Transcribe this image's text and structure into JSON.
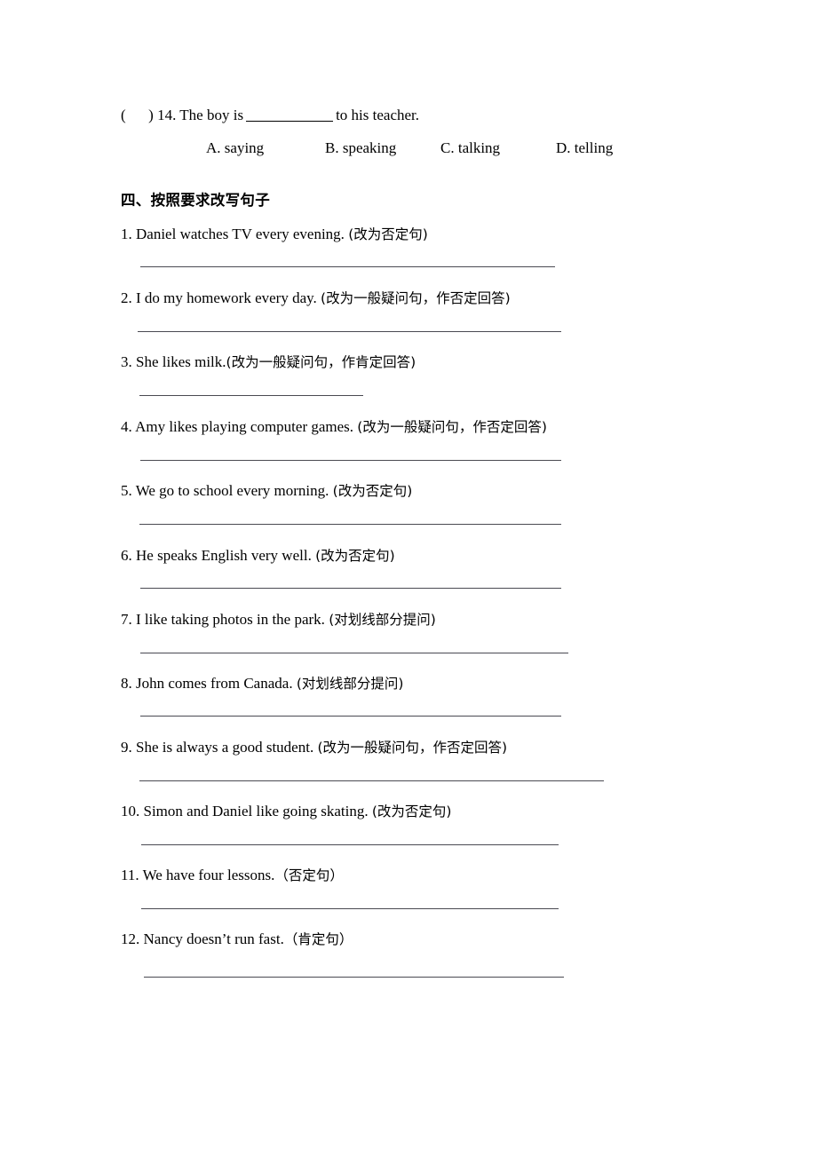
{
  "document": {
    "multiple_choice": {
      "bracket_open": "(",
      "bracket_close": ")",
      "number": "14.",
      "stem_before_blank": "The boy is",
      "stem_after_blank": "to his teacher.",
      "options": [
        {
          "key": "A.",
          "text": "saying"
        },
        {
          "key": "B.",
          "text": "speaking"
        },
        {
          "key": "C.",
          "text": "talking"
        },
        {
          "key": "D.",
          "text": "telling"
        }
      ],
      "full_line": "(      ) 14. The boy is __________ to his teacher."
    },
    "section": {
      "heading": "四、按照要求改写句子"
    },
    "items": [
      {
        "number": "1.",
        "sentence": "Daniel watches TV every evening.",
        "instruction": "(改为否定句)"
      },
      {
        "number": "2.",
        "sentence": "I do my homework every day.",
        "instruction": "(改为一般疑问句，作否定回答)"
      },
      {
        "number": "3.",
        "sentence": "She likes milk.",
        "instruction": "(改为一般疑问句，作肯定回答)"
      },
      {
        "number": "4.",
        "sentence": "Amy likes playing computer games.",
        "instruction": "(改为一般疑问句，作否定回答)"
      },
      {
        "number": "5.",
        "sentence": "We go to school every morning.",
        "instruction": "(改为否定句)"
      },
      {
        "number": "6.",
        "sentence": "He speaks English very well.",
        "instruction": "(改为否定句)"
      },
      {
        "number": "7.",
        "sentence": "I like taking photos in the park.",
        "instruction": "(对划线部分提问)"
      },
      {
        "number": "8.",
        "sentence": "John comes from Canada.",
        "instruction": "(对划线部分提问)"
      },
      {
        "number": "9.",
        "sentence": "She is always a good student.",
        "instruction": "(改为一般疑问句，作否定回答)"
      },
      {
        "number": "10.",
        "sentence": "Simon and Daniel like going skating.",
        "instruction": "(改为否定句)"
      },
      {
        "number": "11.",
        "sentence": "We have four lessons.",
        "instruction": "（否定句）"
      },
      {
        "number": "12.",
        "sentence": "Nancy doesn’t run fast.",
        "instruction": "（肯定句）"
      }
    ],
    "colors": {
      "text": "#000000",
      "rule": "#4a4a52",
      "background": "#ffffff"
    }
  }
}
